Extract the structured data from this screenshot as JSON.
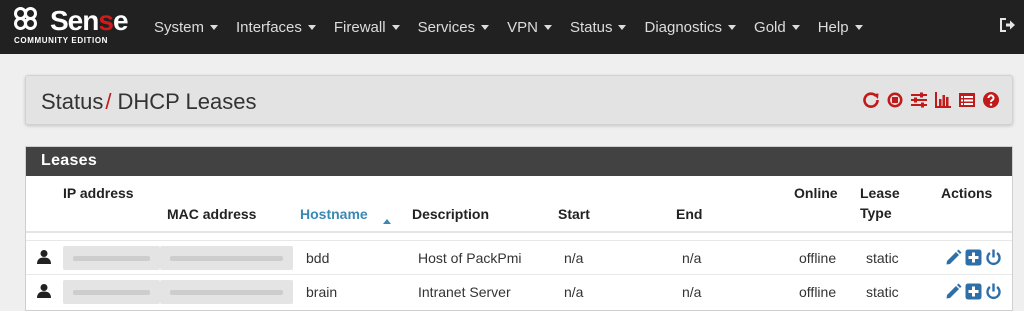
{
  "brand": {
    "name_pre": "Sen",
    "name_accent": "s",
    "name_post": "e",
    "edition": "COMMUNITY EDITION"
  },
  "nav": {
    "items": [
      {
        "label": "System"
      },
      {
        "label": "Interfaces"
      },
      {
        "label": "Firewall"
      },
      {
        "label": "Services"
      },
      {
        "label": "VPN"
      },
      {
        "label": "Status"
      },
      {
        "label": "Diagnostics"
      },
      {
        "label": "Gold"
      },
      {
        "label": "Help"
      }
    ],
    "logout_icon": "sign-out-icon"
  },
  "breadcrumb": {
    "section": "Status",
    "separator": "/",
    "page": "DHCP Leases"
  },
  "toolbar_icons": [
    "reload-icon",
    "stop-circle-icon",
    "sliders-icon",
    "bar-chart-icon",
    "list-icon",
    "help-circle-icon"
  ],
  "panel": {
    "title": "Leases",
    "columns": {
      "ip": "IP address",
      "mac": "MAC address",
      "hostname": "Hostname",
      "description": "Description",
      "start": "Start",
      "end": "End",
      "online": "Online",
      "lease_type_1": "Lease",
      "lease_type_2": "Type",
      "actions": "Actions"
    },
    "sorted_column": "hostname",
    "rows": [
      {
        "hostname": "bdd",
        "description": "Host of PackPmi",
        "start": "n/a",
        "end": "n/a",
        "online": "offline",
        "lease_type": "static"
      },
      {
        "hostname": "brain",
        "description": "Intranet Server",
        "start": "n/a",
        "end": "n/a",
        "online": "offline",
        "lease_type": "static"
      }
    ]
  },
  "colors": {
    "accent_red": "#c11a1a",
    "link_blue": "#3a89b5",
    "navbar": "#212121",
    "panel_header": "#424242"
  }
}
